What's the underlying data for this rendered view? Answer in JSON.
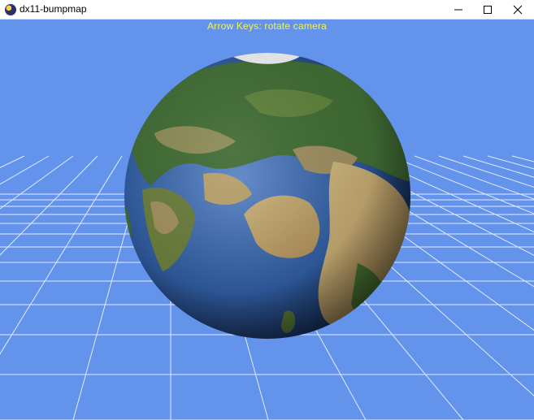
{
  "window": {
    "title": "dx11-bumpmap",
    "controls": {
      "minimize": "minimize-icon",
      "maximize": "maximize-icon",
      "close": "close-icon"
    }
  },
  "viewport": {
    "background_color": "#6493ec",
    "grid_color": "#e9f0ff",
    "instruction_color": "#f2f25a",
    "instruction": "Arrow Keys: rotate camera"
  }
}
